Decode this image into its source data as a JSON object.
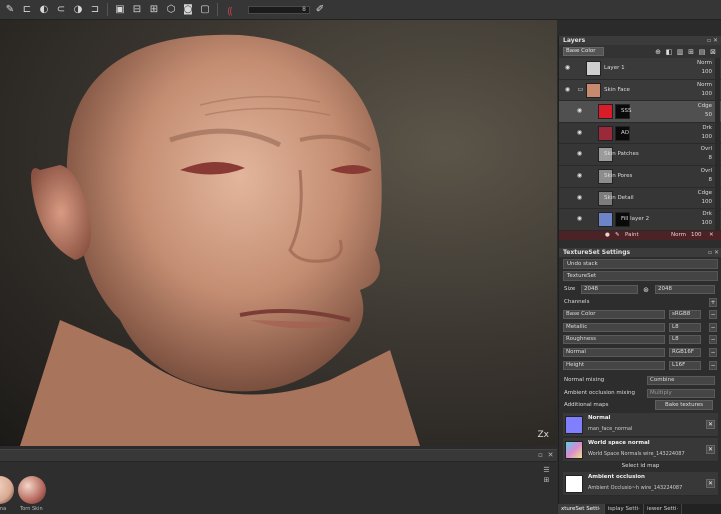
{
  "toolbar": {
    "icons": [
      "brush-icon",
      "eraser-icon",
      "projection-icon",
      "polyfill-icon",
      "smudge-icon",
      "clone-icon",
      "material-picker-icon",
      "layer-icon",
      "camera-icon",
      "bake-icon",
      "record-icon"
    ],
    "slider_value": "8"
  },
  "viewport": {
    "axis_label": "Zx"
  },
  "shelf": {
    "materials": [
      {
        "label": "na",
        "color": "#d9a992"
      },
      {
        "label": "Torn Skin",
        "color": "#b6675e"
      }
    ]
  },
  "layers": {
    "title": "Layers",
    "blend_select": "Base Color",
    "rows": [
      {
        "name": "Layer 1",
        "blend": "Norm",
        "opacity": "100",
        "thumb": "#cfcfcf",
        "sub": false,
        "selected": false,
        "mask": false
      },
      {
        "name": "Skin Face",
        "blend": "Norm",
        "opacity": "100",
        "thumb": "#c78a6f",
        "sub": false,
        "selected": false,
        "mask": false,
        "folder": true
      },
      {
        "name": "SSS",
        "blend": "Cdge",
        "opacity": "50",
        "thumb": "#d81c2a",
        "sub": true,
        "selected": true,
        "mask": true
      },
      {
        "name": "AO",
        "blend": "Drk",
        "opacity": "100",
        "thumb": "#9a2a3a",
        "sub": true,
        "selected": false,
        "mask": true
      },
      {
        "name": "Skin Patches",
        "blend": "Ovrl",
        "opacity": "8",
        "thumb": "#9b9b9b",
        "sub": true,
        "selected": false,
        "mask": false
      },
      {
        "name": "Skin Pores",
        "blend": "Ovrl",
        "opacity": "8",
        "thumb": "#8d8d8d",
        "sub": true,
        "selected": false,
        "mask": false
      },
      {
        "name": "Skin Detail",
        "blend": "Cdge",
        "opacity": "100",
        "thumb": "#7d7d7d",
        "sub": true,
        "selected": false,
        "mask": false
      },
      {
        "name": "Fill layer 2",
        "blend": "Drk",
        "opacity": "100",
        "thumb": "#6d84c7",
        "sub": true,
        "selected": false,
        "mask": true
      }
    ],
    "paint_row": {
      "name": "Paint",
      "blend": "Norm",
      "opacity": "100"
    }
  },
  "textureset": {
    "title": "TextureSet Settings",
    "undo_stack": "Undo stack",
    "textureset_label": "TextureSet",
    "size_label": "Size",
    "size_value": "2048",
    "size_value2": "2048",
    "channels_label": "Channels",
    "channels": [
      {
        "name": "Base Color",
        "format": "sRGB8"
      },
      {
        "name": "Metallic",
        "format": "L8"
      },
      {
        "name": "Roughness",
        "format": "L8"
      },
      {
        "name": "Normal",
        "format": "RGB16F"
      },
      {
        "name": "Height",
        "format": "L16F"
      }
    ],
    "normal_mixing_label": "Normal mixing",
    "normal_mixing_value": "Combine",
    "ao_mixing_label": "Ambient occlusion mixing",
    "ao_mixing_value": "Multiply",
    "additional_maps_label": "Additional maps",
    "bake_button": "Bake textures",
    "maps": [
      {
        "title": "Normal",
        "sub": "man_face_normal",
        "color": "#8080ff"
      },
      {
        "title": "World space normal",
        "sub": "World Space Normals wire_143224087",
        "color": "#d88bd0"
      },
      {
        "title": "Ambient occlusion",
        "sub": "Ambient Occlusio~h wire_143224087",
        "color": "#ffffff"
      }
    ],
    "select_id_map": "Select id map"
  },
  "bottom_tabs": [
    "xtureSet Setti·",
    "isplay Setti·",
    "iewer Setti·"
  ]
}
